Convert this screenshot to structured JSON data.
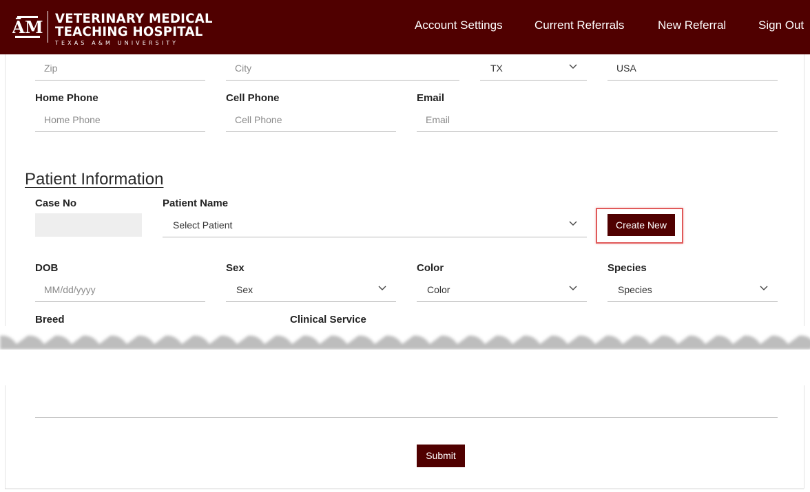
{
  "header": {
    "logo": {
      "line1": "VETERINARY MEDICAL",
      "line2": "TEACHING HOSPITAL",
      "line3": "TEXAS A&M UNIVERSITY",
      "mark": "ATM"
    },
    "nav": [
      "Account Settings",
      "Current Referrals",
      "New Referral",
      "Sign Out"
    ]
  },
  "address_row": {
    "zip_placeholder": "Zip",
    "city_placeholder": "City",
    "state_value": "TX",
    "country_value": "USA"
  },
  "contact_row": {
    "home_phone_label": "Home Phone",
    "home_phone_placeholder": "Home Phone",
    "cell_phone_label": "Cell Phone",
    "cell_phone_placeholder": "Cell Phone",
    "email_label": "Email",
    "email_placeholder": "Email"
  },
  "patient": {
    "section_title": "Patient Information",
    "case_no_label": "Case No",
    "patient_name_label": "Patient Name",
    "patient_select_placeholder": "Select Patient",
    "create_new_label": "Create New",
    "dob_label": "DOB",
    "dob_placeholder": "MM/dd/yyyy",
    "sex_label": "Sex",
    "sex_value": "Sex",
    "color_label": "Color",
    "color_value": "Color",
    "species_label": "Species",
    "species_value": "Species",
    "breed_label": "Breed",
    "clinical_service_label": "Clinical Service"
  },
  "footer": {
    "submit_label": "Submit"
  },
  "colors": {
    "brand": "#500000",
    "highlight": "#e05a5a",
    "field_border": "#b8b8b8"
  }
}
